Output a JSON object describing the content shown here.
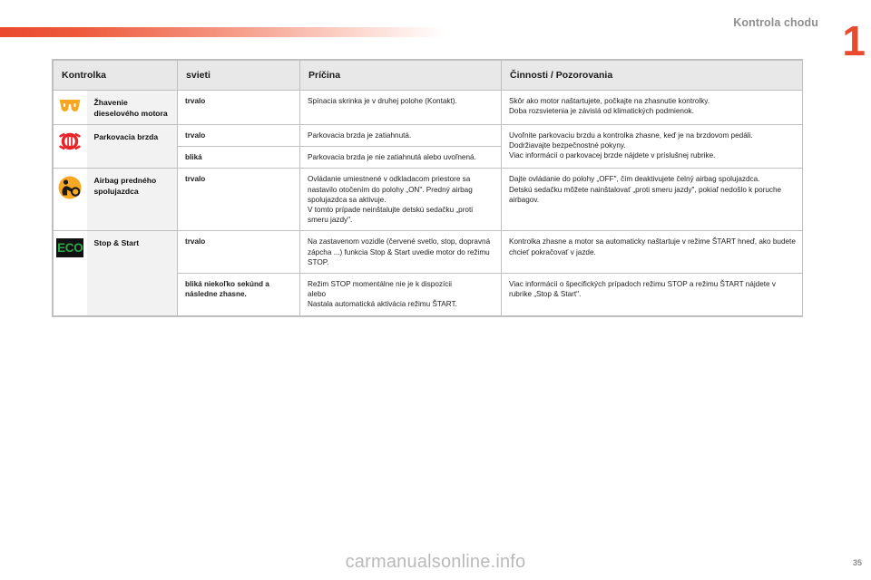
{
  "header": {
    "chapter_title": "Kontrola chodu",
    "chapter_number": "1"
  },
  "footer": {
    "watermark": "carmanualsonline.info",
    "page_number": "35"
  },
  "table": {
    "columns": [
      "Kontrolka",
      "svieti",
      "Príčina",
      "Činnosti / Pozorovania"
    ],
    "rows": [
      {
        "icon": "diesel-glow-plug-icon",
        "name": "Žhavenie dieselového motora",
        "states": [
          {
            "state": "trvalo",
            "cause": "Spínacia skrinka je v druhej polohe (Kontakt).",
            "action": "Skôr ako motor naštartujete, počkajte na zhasnutie kontrolky.\nDoba rozsvietenia je závislá od klimatických podmienok."
          }
        ]
      },
      {
        "icon": "parking-brake-icon",
        "name": "Parkovacia brzda",
        "states": [
          {
            "state": "trvalo",
            "cause": "Parkovacia brzda je zatiahnutá.",
            "action": "Uvoľnite parkovaciu brzdu a kontrolka zhasne, keď je na brzdovom pedáli.\nDodržiavajte bezpečnostné pokyny.\nViac informácií o parkovacej brzde nájdete v príslušnej rubrike."
          },
          {
            "state": "bliká",
            "cause": "Parkovacia brzda je nie zatiahnutá alebo uvoľnená.",
            "action": ""
          }
        ]
      },
      {
        "icon": "passenger-airbag-icon",
        "name": "Airbag predného spolujazdca",
        "states": [
          {
            "state": "trvalo",
            "cause": "Ovládanie umiestnené v odkladacom priestore sa nastavilo otočením do polohy „ON\". Predný airbag spolujazdca sa aktivuje.\nV tomto prípade neinštalujte detskú sedačku „proti smeru jazdy\".",
            "action": "Dajte ovládanie do polohy „OFF\", čím deaktivujete čelný airbag spolujazdca.\nDetskú sedačku môžete nainštalovať „proti smeru jazdy\", pokiaľ nedošlo k poruche airbagov."
          }
        ]
      },
      {
        "icon": "eco-stop-start-icon",
        "name": "Stop & Start",
        "states": [
          {
            "state": "trvalo",
            "cause": "Na zastavenom vozidle (červené svetlo, stop, dopravná zápcha ...) funkcia Stop & Start uvedie motor do režimu STOP.",
            "action": "Kontrolka zhasne a motor sa automaticky naštartuje v režime ŠTART hneď, ako budete chcieť pokračovať v jazde."
          },
          {
            "state": "bliká niekoľko sekúnd a následne zhasne.",
            "cause": "Režim STOP momentálne nie je k dispozícii\nalebo\nNastala automatická aktivácia režimu ŠTART.",
            "action": "Viac informácií o špecifických prípadoch režimu STOP a režimu ŠTART nájdete v rubrike „Stop & Start\"."
          }
        ]
      }
    ]
  }
}
